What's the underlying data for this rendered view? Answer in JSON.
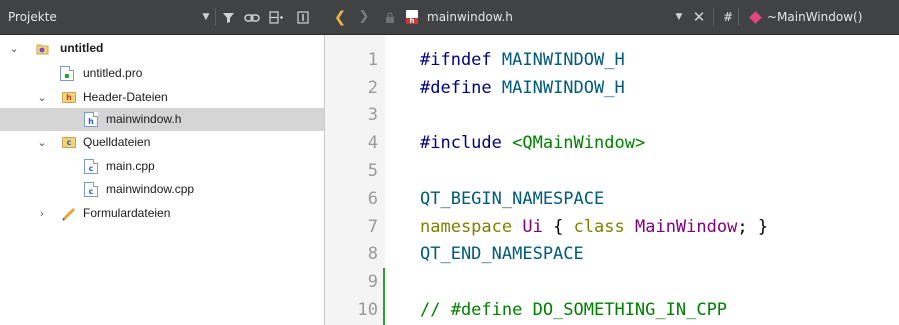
{
  "toolbar": {
    "panel_title": "Projekte",
    "filter_icon": "filter-icon",
    "link_icon": "link-icon",
    "split_icon": "split-icon",
    "close_panel_icon": "close-panel-icon",
    "file_name": "mainwindow.h",
    "hash_label": "#",
    "symbol_label": "~MainWindow()",
    "accent_color": "#e0457b"
  },
  "tree": {
    "items": [
      {
        "label": "untitled",
        "icon": "project-icon",
        "expanded": true
      },
      {
        "label": "untitled.pro",
        "icon": "pro-file-icon"
      },
      {
        "label": "Header-Dateien",
        "icon": "header-folder-icon",
        "expanded": true
      },
      {
        "label": "mainwindow.h",
        "icon": "header-file-icon",
        "selected": true
      },
      {
        "label": "Quelldateien",
        "icon": "source-folder-icon",
        "expanded": true
      },
      {
        "label": "main.cpp",
        "icon": "cpp-file-icon"
      },
      {
        "label": "mainwindow.cpp",
        "icon": "cpp-file-icon"
      },
      {
        "label": "Formulardateien",
        "icon": "form-folder-icon",
        "expanded": false
      }
    ]
  },
  "editor": {
    "line_numbers": [
      "1",
      "2",
      "3",
      "4",
      "5",
      "6",
      "7",
      "8",
      "9",
      "10"
    ],
    "code": {
      "l1_pp": "#ifndef",
      "l1_mac": " MAINWINDOW_H",
      "l2_pp": "#define",
      "l2_mac": " MAINWINDOW_H",
      "l4_pp": "#include",
      "l4_inc": " <QMainWindow>",
      "l6_mac": "QT_BEGIN_NAMESPACE",
      "l7_kw1": "namespace",
      "l7_ns": " Ui ",
      "l7_b1": "{ ",
      "l7_kw2": "class",
      "l7_cls": " MainWindow",
      "l7_b2": "; }",
      "l8_mac": "QT_END_NAMESPACE",
      "l10_cm": "// #define DO_SOMETHING_IN_CPP"
    },
    "changed_lines": [
      "9",
      "10"
    ]
  }
}
